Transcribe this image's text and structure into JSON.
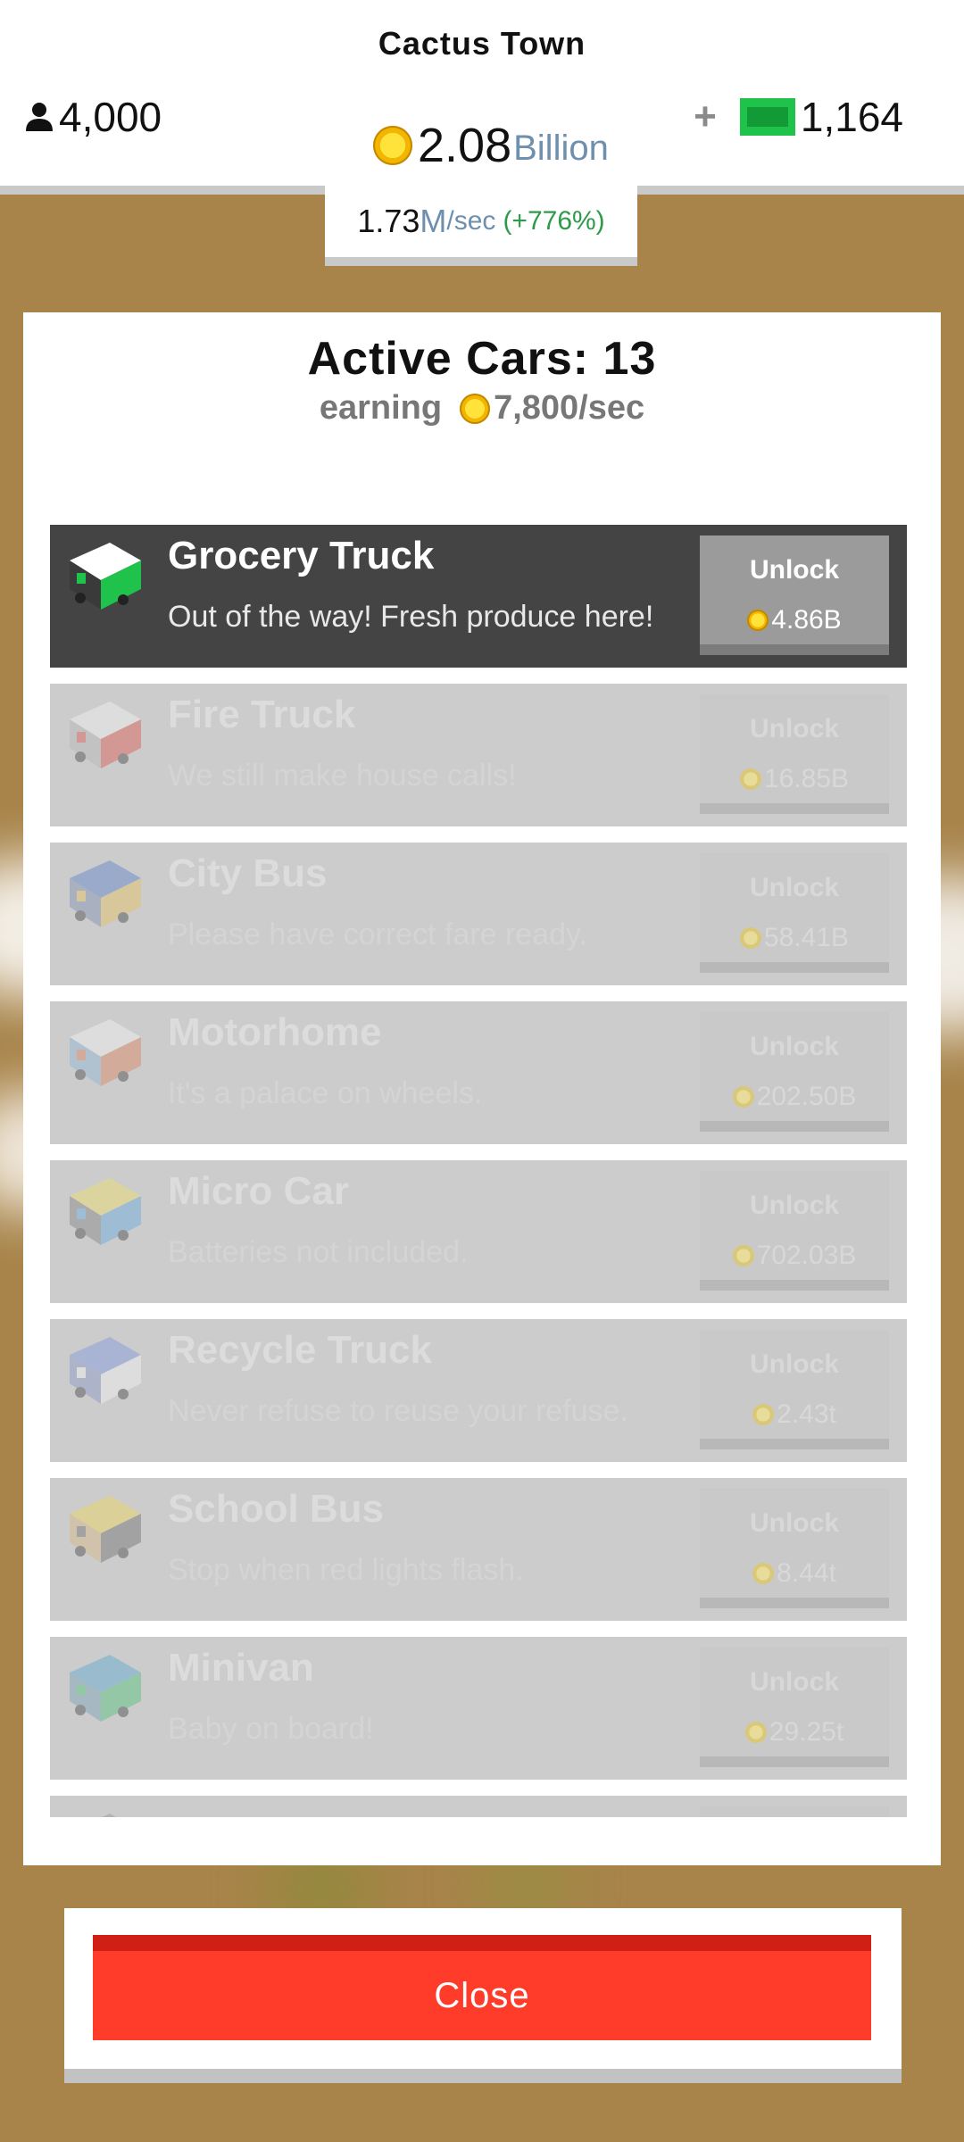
{
  "header": {
    "town_name": "Cactus Town",
    "population": "4,000",
    "cash_amount": "2.08",
    "cash_unit": "Billion",
    "gems": "1,164",
    "gems_add": "+",
    "rate_value": "1.73",
    "rate_unit": "M",
    "rate_suffix": "/sec",
    "rate_bonus": "(+776%)"
  },
  "panel": {
    "title": "Active Cars: 13",
    "earning_label": "earning",
    "earning_value": "7,800/sec"
  },
  "cars": [
    {
      "name": "Grocery Truck",
      "desc": "Out of the way! Fresh produce here!",
      "unlock_label": "Unlock",
      "price": "4.86B",
      "active": true,
      "icon": "grocery-truck-icon"
    },
    {
      "name": "Fire Truck",
      "desc": "We still make house calls!",
      "unlock_label": "Unlock",
      "price": "16.85B",
      "active": false,
      "icon": "fire-truck-icon"
    },
    {
      "name": "City Bus",
      "desc": "Please have correct fare ready.",
      "unlock_label": "Unlock",
      "price": "58.41B",
      "active": false,
      "icon": "city-bus-icon"
    },
    {
      "name": "Motorhome",
      "desc": "It's a palace on wheels.",
      "unlock_label": "Unlock",
      "price": "202.50B",
      "active": false,
      "icon": "motorhome-icon"
    },
    {
      "name": "Micro Car",
      "desc": "Batteries not included.",
      "unlock_label": "Unlock",
      "price": "702.03B",
      "active": false,
      "icon": "micro-car-icon"
    },
    {
      "name": "Recycle Truck",
      "desc": "Never refuse to reuse your refuse.",
      "unlock_label": "Unlock",
      "price": "2.43t",
      "active": false,
      "icon": "recycle-truck-icon"
    },
    {
      "name": "School Bus",
      "desc": "Stop when red lights flash.",
      "unlock_label": "Unlock",
      "price": "8.44t",
      "active": false,
      "icon": "school-bus-icon"
    },
    {
      "name": "Minivan",
      "desc": "Baby on board!",
      "unlock_label": "Unlock",
      "price": "29.25t",
      "active": false,
      "icon": "minivan-icon"
    },
    {
      "name": "",
      "desc": "",
      "unlock_label": "",
      "price": "",
      "active": false,
      "icon": "car-icon"
    }
  ],
  "close_label": "Close",
  "colors": {
    "accent_red": "#ff3b2a",
    "active_row": "#444444",
    "locked_row": "#cccccc",
    "cash_unit": "#6f8fae",
    "bonus_green": "#2e9a4a",
    "gem_green": "#1fc24a"
  }
}
